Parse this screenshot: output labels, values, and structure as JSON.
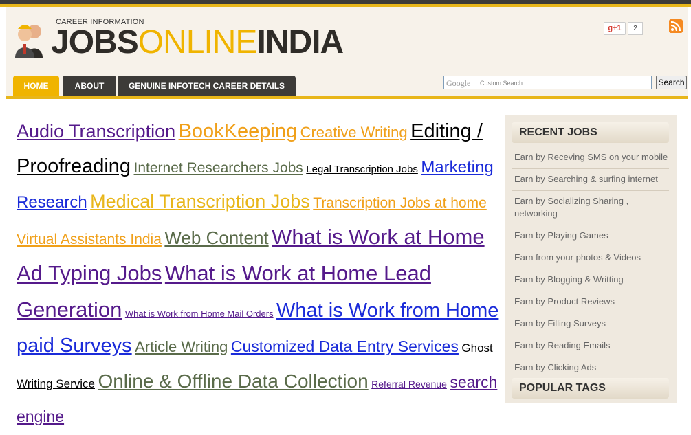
{
  "header": {
    "tagline": "CAREER INFORMATION",
    "brand_part1": "JOBS",
    "brand_part2": "ONLINE",
    "brand_part3": "INDIA",
    "gplus_label": "g+1",
    "gplus_count": "2"
  },
  "nav": {
    "tabs": [
      {
        "label": "HOME",
        "active": true
      },
      {
        "label": "ABOUT",
        "active": false
      },
      {
        "label": "GENUINE INFOTECH CAREER DETAILS",
        "active": false
      }
    ]
  },
  "search": {
    "google_logo": "Google",
    "placeholder": "Custom Search",
    "button_label": "Search"
  },
  "tag_cloud": [
    {
      "text": "Audio Transcription",
      "size": 27,
      "color": "#551a8b"
    },
    {
      "text": "BookKeeping",
      "size": 29,
      "color": "#f0a01a"
    },
    {
      "text": "Creative Writing",
      "size": 22,
      "color": "#f0a01a"
    },
    {
      "text": "Editing / Proofreading",
      "size": 29,
      "color": "#000000"
    },
    {
      "text": "Internet Researchers Jobs",
      "size": 21,
      "color": "#5a6b4a"
    },
    {
      "text": "Legal Transcription Jobs",
      "size": 15,
      "color": "#000000"
    },
    {
      "text": "Marketing Research",
      "size": 24,
      "color": "#1a2bd9"
    },
    {
      "text": "Medical Transcription Jobs",
      "size": 27,
      "color": "#e8b61a"
    },
    {
      "text": "Transcription Jobs at home",
      "size": 21,
      "color": "#f0a01a"
    },
    {
      "text": "Virtual Assistants India",
      "size": 21,
      "color": "#f0a01a"
    },
    {
      "text": "Web Content",
      "size": 26,
      "color": "#5a6b4a"
    },
    {
      "text": "What is Work at Home Ad Typing Jobs",
      "size": 31,
      "color": "#551a8b"
    },
    {
      "text": "What is Work at Home Lead Generation",
      "size": 31,
      "color": "#551a8b"
    },
    {
      "text": "What is Work from Home Mail Orders",
      "size": 13,
      "color": "#551a8b"
    },
    {
      "text": "What is Work from Home paid Surveys",
      "size": 29,
      "color": "#1a2bd9"
    },
    {
      "text": "Article Writing",
      "size": 22,
      "color": "#5a6b4a"
    },
    {
      "text": "Customized Data Entry Services",
      "size": 23,
      "color": "#1a2bd9"
    },
    {
      "text": "Ghost Writing Service",
      "size": 17,
      "color": "#000000"
    },
    {
      "text": "Online & Offline Data Collection",
      "size": 28,
      "color": "#5a6b4a"
    },
    {
      "text": "Referral Revenue",
      "size": 14,
      "color": "#551a8b"
    },
    {
      "text": "search engine",
      "size": 23,
      "color": "#551a8b"
    }
  ],
  "sidebar": {
    "recent_title": "RECENT JOBS",
    "recent_items": [
      "Earn by Receving SMS on your mobile",
      "Earn by Searching & surfing internet",
      "Earn by Socializing Sharing , networking",
      "Earn by Playing Games",
      "Earn from your photos & Videos",
      "Earn by Blogging & Writting",
      "Earn by Product Reviews",
      "Earn by Filling Surveys",
      "Earn by Reading Emails",
      "Earn by Clicking Ads"
    ],
    "popular_title": "POPULAR TAGS"
  },
  "colors": {
    "accent": "#e8b61a",
    "dark_tab": "#3d3b38",
    "header_bg": "#f7f2ea",
    "sidebar_bg": "#efe9df"
  }
}
